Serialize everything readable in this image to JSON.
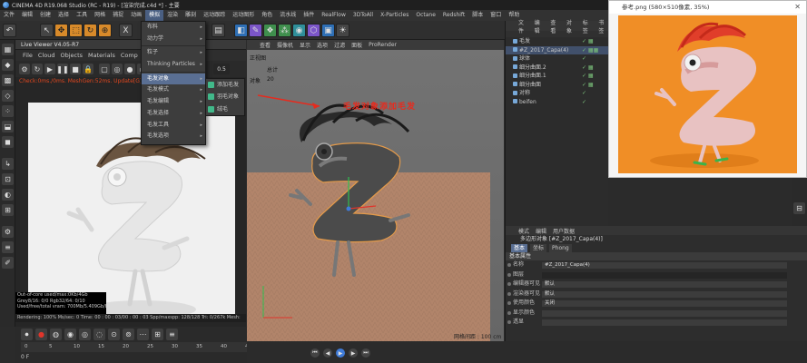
{
  "window": {
    "title": "CINEMA 4D R19.068 Studio (RC - R19) - [渲染完成.c4d *] - 主要"
  },
  "menubar": [
    "文件",
    "编辑",
    "创建",
    "选择",
    "工具",
    "网格",
    "捕捉",
    "动画",
    "模拟",
    "渲染",
    "雕刻",
    "运动跟踪",
    "运动图形",
    "角色",
    "流水线",
    "插件",
    "RealFlow",
    "3DToAll",
    "X-Particles",
    "Octane",
    "Redshift",
    "脚本",
    "窗口",
    "帮助"
  ],
  "menubar_active_index": 8,
  "dropdown": {
    "items": [
      {
        "label": "布料",
        "arrow": "▸"
      },
      {
        "label": "动力学",
        "arrow": "▸"
      },
      {
        "label": "粒子",
        "arrow": "▸"
      },
      {
        "label": "Thinking Particles",
        "arrow": "▸"
      },
      {
        "label": "毛发对象",
        "arrow": "▸"
      },
      {
        "label": "毛发模式",
        "arrow": "▸"
      },
      {
        "label": "毛发编辑",
        "arrow": "▸"
      },
      {
        "label": "毛发选择",
        "arrow": "▸"
      },
      {
        "label": "毛发工具",
        "arrow": "▸"
      },
      {
        "label": "毛发选项",
        "arrow": "▸"
      }
    ],
    "highlighted_index": 4,
    "submenu": [
      "添加毛发",
      "羽毛对象",
      "绒毛"
    ]
  },
  "live_viewer": {
    "title": "Live Viewer V4.05-R7",
    "menu": [
      "File",
      "Cloud",
      "Objects",
      "Materials",
      "Comp",
      "uil"
    ],
    "zoom": "0.5",
    "status": "Check:0ms./0ms. MeshGen:52ms. Update[G]:107ms. Nodes:112 Movable:0 0 0",
    "info": [
      "Out-of-core used/max:0Kb/4Gb",
      "Grey8/16: 0/0    Rgb32/64: 0/10",
      "Used/free/total vram: 700Mb/5.409Gb/8Gb"
    ],
    "bottom": "Rendering: 100%   Ms/sec: 0   Time: 00 : 00 : 03/00 : 00 : 03   Spp/maxspp: 128/128   Tri: 0/267k   Mesh:"
  },
  "viewport": {
    "menu": [
      "查看",
      "摄像机",
      "显示",
      "选项",
      "过滤",
      "面板",
      "ProRender"
    ],
    "view_name": "正视图",
    "stat_label": "总计",
    "objects_label": "对象",
    "objects_count": "20",
    "annotation": "毛发对象添加毛发",
    "grid_spacing": "网格间距 : 100 cm"
  },
  "object_manager": {
    "tabs": [
      "文件",
      "编辑",
      "查看",
      "对象",
      "标签",
      "书签"
    ],
    "rows": [
      {
        "label": "毛发",
        "flags": "✓ ▦",
        "selected": false
      },
      {
        "label": "#Z_2017_Capa(4)",
        "flags": "✓ ▦▦",
        "selected": true
      },
      {
        "label": "球体",
        "flags": "✓",
        "selected": false
      },
      {
        "label": "细分曲面.2",
        "flags": "✓ ▦",
        "selected": false
      },
      {
        "label": "细分曲面.1",
        "flags": "✓ ▦",
        "selected": false
      },
      {
        "label": "细分曲面",
        "flags": "✓ ▦",
        "selected": false
      },
      {
        "label": "对称",
        "flags": "✓",
        "selected": false
      },
      {
        "label": "beifen",
        "flags": "✓",
        "selected": false
      }
    ]
  },
  "attributes": {
    "tabs": [
      "模式",
      "编辑",
      "用户数据"
    ],
    "title": "多边形对象 [#Z_2017_Capa(4)]",
    "subtabs": [
      "基本",
      "坐标",
      "Phong"
    ],
    "section": "基本属性",
    "fields": [
      {
        "label": "名称",
        "value": "#Z_2017_Capa(4)",
        "dark": false
      },
      {
        "label": "图层",
        "value": "",
        "dark": true
      },
      {
        "label": "编辑器可见",
        "value": "默认",
        "dark": false
      },
      {
        "label": "渲染器可见",
        "value": "默认",
        "dark": false
      },
      {
        "label": "使用颜色",
        "value": "关闭",
        "dark": false
      },
      {
        "label": "显示颜色",
        "value": "",
        "dark": false
      },
      {
        "label": "透显",
        "value": "",
        "dark": false
      }
    ]
  },
  "reference": {
    "title": "参考.png (580×510像素, 35%)",
    "close": "✕"
  },
  "timeline": {
    "ticks": [
      "0",
      "5",
      "10",
      "15",
      "20",
      "25",
      "30",
      "35",
      "40",
      "45"
    ],
    "frame": "0 F"
  },
  "colors": {
    "accent": "#5a6f93",
    "error_text": "#e0471f",
    "annotation": "#e62b1e",
    "ref_bg": "#f08e26"
  }
}
